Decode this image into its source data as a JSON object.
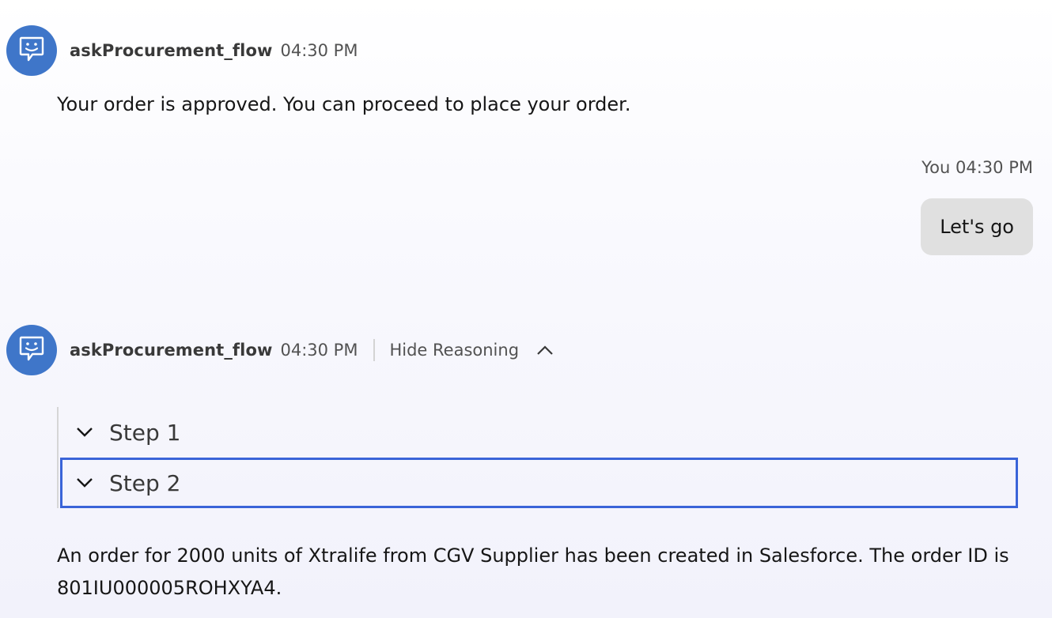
{
  "messages": [
    {
      "sender": "askProcurement_flow",
      "time": "04:30 PM",
      "text": "Your order is approved. You can proceed to place your order."
    },
    {
      "sender": "askProcurement_flow",
      "time": "04:30 PM",
      "reasoning_label": "Hide Reasoning",
      "steps": [
        "Step 1",
        "Step 2"
      ],
      "text": "An order for 2000 units of Xtralife from CGV Supplier has been created in Salesforce. The order ID is 801IU000005ROHXYA4."
    }
  ],
  "user_message": {
    "meta": "You 04:30 PM",
    "text": "Let's go"
  },
  "colors": {
    "avatar_bg": "#3f76c9",
    "user_bubble_bg": "#e0e0e0",
    "focus_border": "#3a64d8"
  },
  "icons": {
    "avatar": "chat-bot-icon",
    "reasoning_toggle": "chevron-up-icon",
    "step": "chevron-down-icon"
  }
}
